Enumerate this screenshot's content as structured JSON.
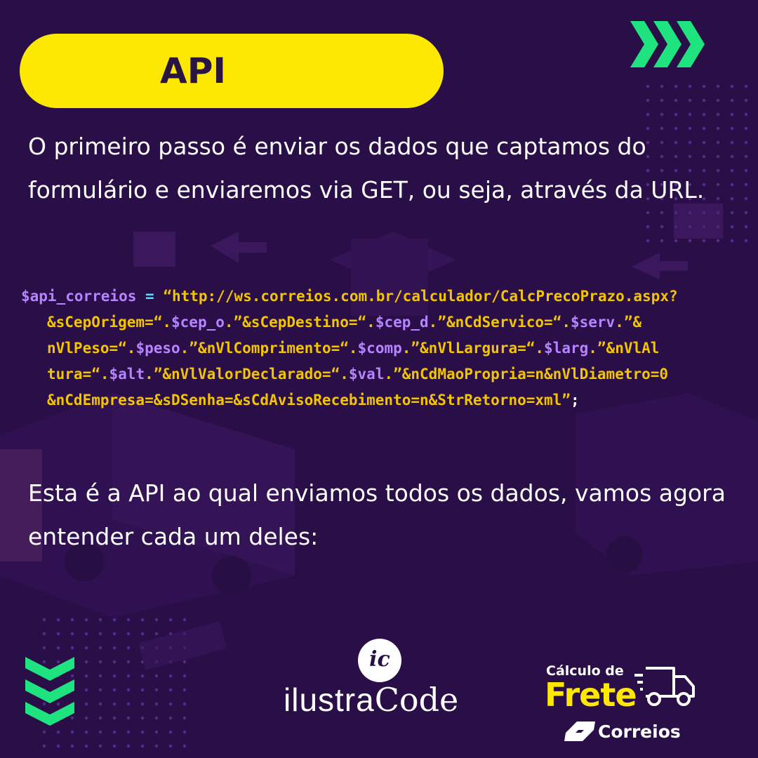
{
  "title": "API",
  "intro_text": "O primeiro passo é enviar os dados que captamos do formulário e enviaremos via GET, ou seja, através da URL.",
  "code": {
    "line1": [
      {
        "t": "$api_correios",
        "c": "var"
      },
      {
        "t": " = ",
        "c": "op"
      },
      {
        "t": "“http://ws.correios.com.br/calculador/CalcPrecoPrazo.aspx?",
        "c": "str"
      }
    ],
    "line2": [
      {
        "t": "&sCepOrigem=“.",
        "c": "str"
      },
      {
        "t": "$cep_o",
        "c": "var"
      },
      {
        "t": ".”&sCepDestino=“.",
        "c": "str"
      },
      {
        "t": "$cep_d",
        "c": "var"
      },
      {
        "t": ".”&nCdServico=“.",
        "c": "str"
      },
      {
        "t": "$serv",
        "c": "var"
      },
      {
        "t": ".”&",
        "c": "str"
      }
    ],
    "line3": [
      {
        "t": "nVlPeso=“.",
        "c": "str"
      },
      {
        "t": "$peso",
        "c": "var"
      },
      {
        "t": ".”&nVlComprimento=“.",
        "c": "str"
      },
      {
        "t": "$comp",
        "c": "var"
      },
      {
        "t": ".”&nVlLargura=“.",
        "c": "str"
      },
      {
        "t": "$larg",
        "c": "var"
      },
      {
        "t": ".”&nVlAl",
        "c": "str"
      }
    ],
    "line4": [
      {
        "t": "tura=“.",
        "c": "str"
      },
      {
        "t": "$alt",
        "c": "var"
      },
      {
        "t": ".”&nVlValorDeclarado=“.",
        "c": "str"
      },
      {
        "t": "$val",
        "c": "var"
      },
      {
        "t": ".”&nCdMaoPropria=n&nVlDiametro=0",
        "c": "str"
      }
    ],
    "line5": [
      {
        "t": "&nCdEmpresa=&sDSenha=&sCdAvisoRecebimento=n&StrRetorno=xml”",
        "c": "str"
      },
      {
        "t": ";",
        "c": "semi"
      }
    ]
  },
  "outro_text": "Esta é a API ao qual enviamos todos os dados, vamos agora entender cada um deles:",
  "brand": {
    "monogram": "ic",
    "name_light": "ilustra",
    "name_bold": "Code"
  },
  "badge": {
    "line1": "Cálculo de",
    "line2": "Frete",
    "carrier": "Correios"
  },
  "colors": {
    "background": "#2a0e47",
    "accent_yellow": "#fde803",
    "accent_green": "#1ee37f",
    "code_string": "#f2c500",
    "code_variable": "#b784ff",
    "code_operator": "#5fd7ff"
  },
  "icons": [
    "chevron-right-triple-icon",
    "chevron-down-triple-icon",
    "delivery-truck-icon",
    "correios-logo-icon"
  ]
}
